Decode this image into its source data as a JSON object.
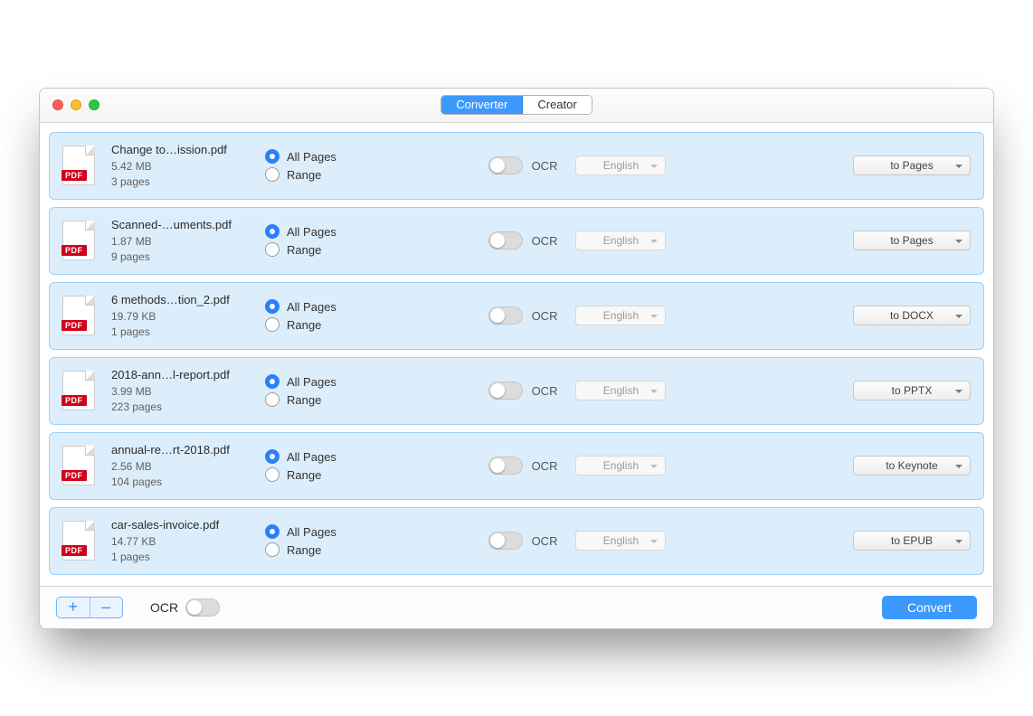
{
  "tabs": {
    "converter": "Converter",
    "creator": "Creator"
  },
  "labels": {
    "allPages": "All Pages",
    "range": "Range",
    "ocr": "OCR",
    "language": "English",
    "pdfTag": "PDF",
    "footerOcr": "OCR",
    "add": "+",
    "remove": "–",
    "convert": "Convert"
  },
  "files": [
    {
      "name": "Change to…ission.pdf",
      "size": "5.42 MB",
      "pages": "3 pages",
      "format": "to Pages"
    },
    {
      "name": "Scanned-…uments.pdf",
      "size": "1.87 MB",
      "pages": "9 pages",
      "format": "to Pages"
    },
    {
      "name": "6 methods…tion_2.pdf",
      "size": "19.79 KB",
      "pages": "1 pages",
      "format": "to DOCX"
    },
    {
      "name": "2018-ann…l-report.pdf",
      "size": "3.99 MB",
      "pages": "223 pages",
      "format": "to PPTX"
    },
    {
      "name": "annual-re…rt-2018.pdf",
      "size": "2.56 MB",
      "pages": "104 pages",
      "format": "to Keynote"
    },
    {
      "name": "car-sales-invoice.pdf",
      "size": "14.77 KB",
      "pages": "1 pages",
      "format": "to EPUB"
    }
  ]
}
